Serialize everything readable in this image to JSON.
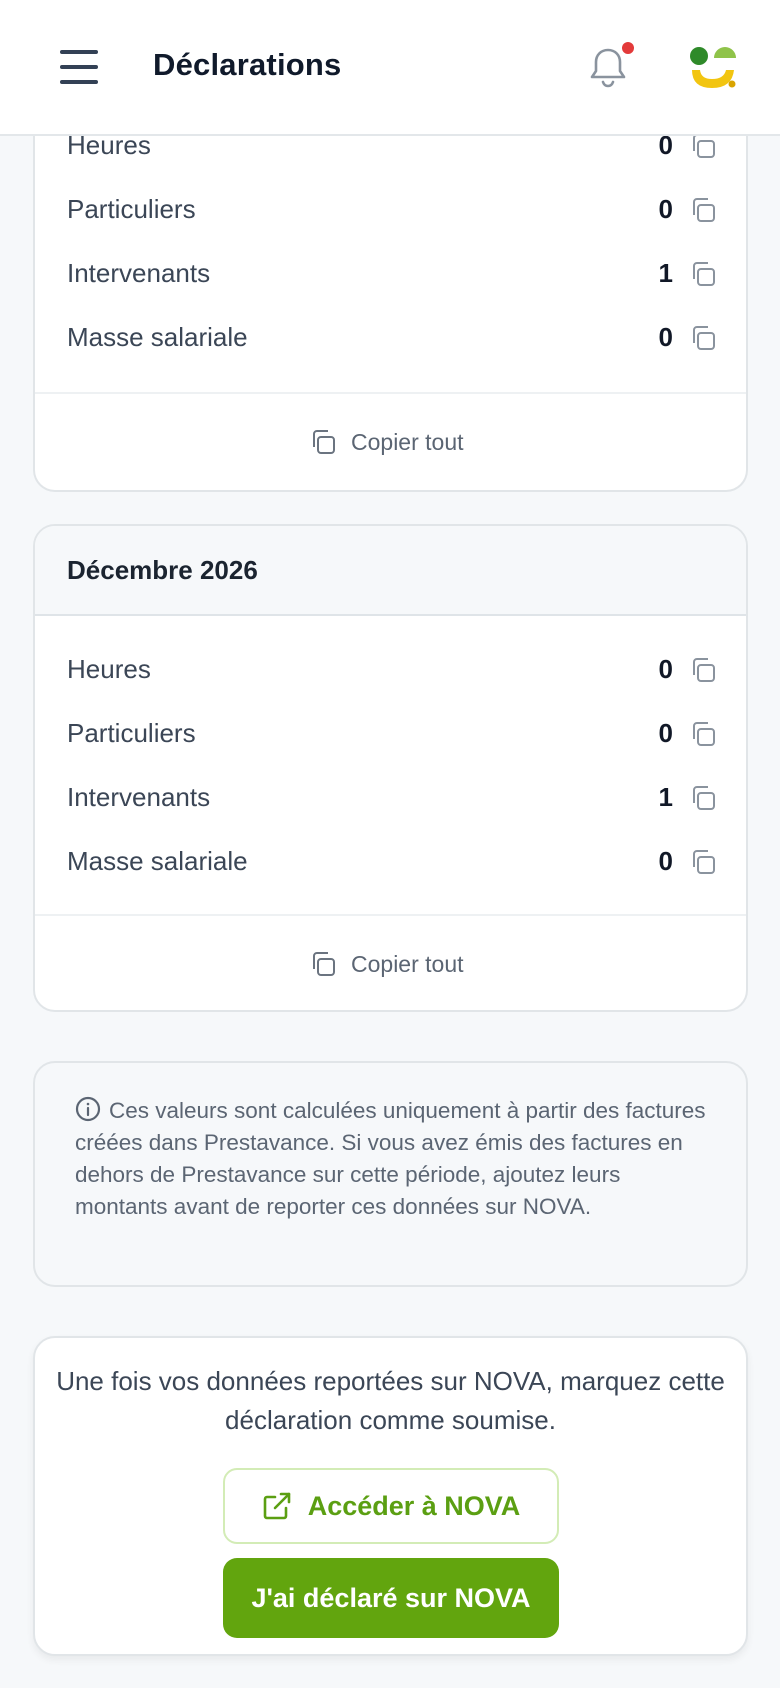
{
  "header": {
    "title": "Déclarations",
    "menu_icon": "hamburger-menu-icon",
    "notification_icon": "bell-icon",
    "has_notification_dot": true,
    "avatar_icon": "brand-logo-avatar"
  },
  "cards": [
    {
      "title": "",
      "rows": [
        {
          "label": "Heures",
          "value": "0"
        },
        {
          "label": "Particuliers",
          "value": "0"
        },
        {
          "label": "Intervenants",
          "value": "1"
        },
        {
          "label": "Masse salariale",
          "value": "0"
        }
      ],
      "copy_all_label": "Copier tout"
    },
    {
      "title": "Décembre 2026",
      "rows": [
        {
          "label": "Heures",
          "value": "0"
        },
        {
          "label": "Particuliers",
          "value": "0"
        },
        {
          "label": "Intervenants",
          "value": "1"
        },
        {
          "label": "Masse salariale",
          "value": "0"
        }
      ],
      "copy_all_label": "Copier tout"
    }
  ],
  "info": {
    "icon": "info-circle-icon",
    "text": "Ces valeurs sont calculées uniquement à partir des factures créées dans Prestavance. Si vous avez émis des factures en dehors de Prestavance sur cette période, ajoutez leurs montants avant de reporter ces données sur NOVA."
  },
  "submit": {
    "text": "Une fois vos données reportées sur NOVA, marquez cette déclaration comme soumise.",
    "open_nova_label": "Accéder à NOVA",
    "declared_label": "J'ai déclaré sur NOVA"
  },
  "colors": {
    "accent": "#62a50e",
    "accent_text": "#5b9f12",
    "notification_dot": "#e33a3a",
    "text_primary": "#1b2430",
    "text_muted": "#5b6573"
  }
}
